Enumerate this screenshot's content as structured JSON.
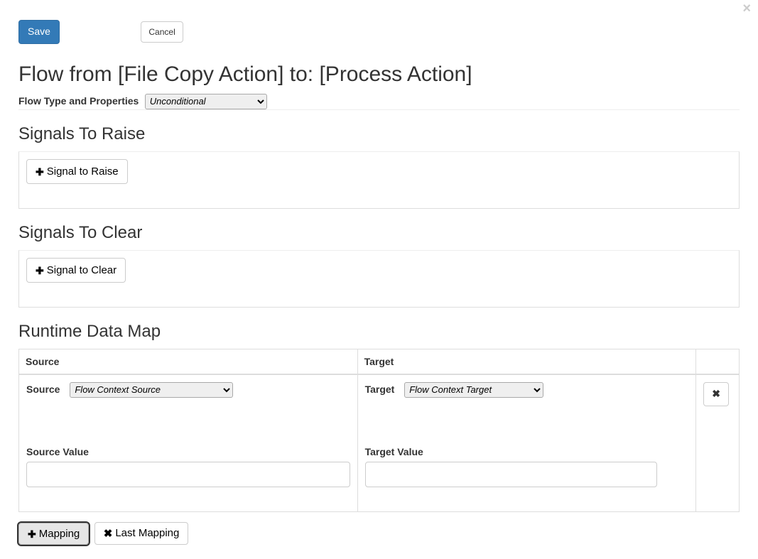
{
  "toolbar": {
    "save_label": "Save",
    "cancel_label": "Cancel"
  },
  "title": "Flow from [File Copy Action] to: [Process Action]",
  "flow_type": {
    "label": "Flow Type and Properties",
    "selected": "Unconditional"
  },
  "signals_raise": {
    "heading": "Signals To Raise",
    "add_label": "Signal to Raise"
  },
  "signals_clear": {
    "heading": "Signals To Clear",
    "add_label": "Signal to Clear"
  },
  "runtime_map": {
    "heading": "Runtime Data Map",
    "cols": {
      "source": "Source",
      "target": "Target"
    },
    "row": {
      "source_label": "Source",
      "source_select": "Flow Context Source",
      "source_value_label": "Source Value",
      "source_value": "",
      "target_label": "Target",
      "target_select": "Flow Context Target",
      "target_value_label": "Target Value",
      "target_value": ""
    }
  },
  "footer": {
    "add_mapping": "Mapping",
    "last_mapping": "Last Mapping"
  }
}
